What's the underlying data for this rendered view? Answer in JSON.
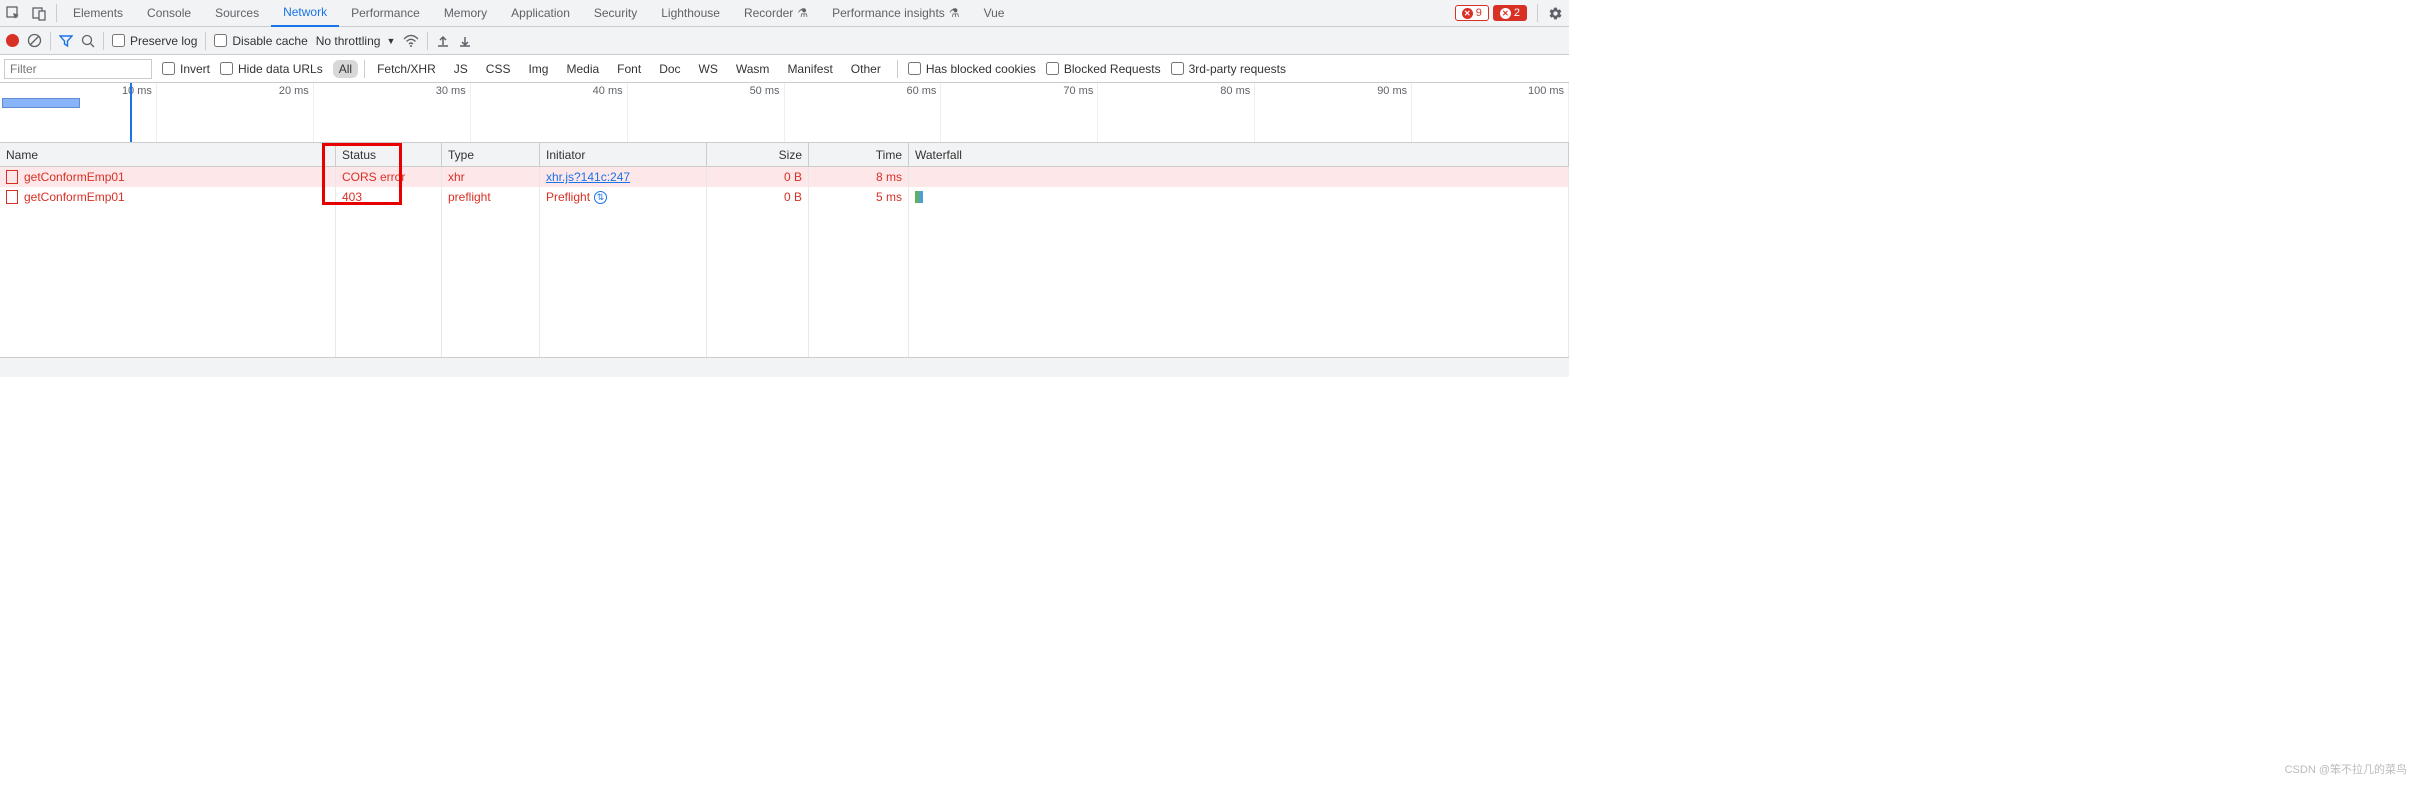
{
  "topbar": {
    "tabs": [
      "Elements",
      "Console",
      "Sources",
      "Network",
      "Performance",
      "Memory",
      "Application",
      "Security",
      "Lighthouse",
      "Recorder",
      "Performance insights",
      "Vue"
    ],
    "active_index": 3,
    "flask_indices": [
      9,
      10
    ],
    "errors_count": "9",
    "errors2_count": "2"
  },
  "toolbar": {
    "preserve_log": "Preserve log",
    "disable_cache": "Disable cache",
    "throttling": "No throttling"
  },
  "filterbar": {
    "filter_placeholder": "Filter",
    "invert": "Invert",
    "hide_data_urls": "Hide data URLs",
    "types": [
      "All",
      "Fetch/XHR",
      "JS",
      "CSS",
      "Img",
      "Media",
      "Font",
      "Doc",
      "WS",
      "Wasm",
      "Manifest",
      "Other"
    ],
    "types_active_index": 0,
    "blocked_cookies": "Has blocked cookies",
    "blocked_requests": "Blocked Requests",
    "third_party": "3rd-party requests"
  },
  "timeline": {
    "labels": [
      "10 ms",
      "20 ms",
      "30 ms",
      "40 ms",
      "50 ms",
      "60 ms",
      "70 ms",
      "80 ms",
      "90 ms",
      "100 ms"
    ]
  },
  "columns": {
    "name": "Name",
    "status": "Status",
    "type": "Type",
    "initiator": "Initiator",
    "size": "Size",
    "time": "Time",
    "waterfall": "Waterfall"
  },
  "rows": [
    {
      "name": "getConformEmp01",
      "status": "CORS error",
      "type": "xhr",
      "initiator": "xhr.js?141c:247",
      "initiator_link": true,
      "size": "0 B",
      "time": "8 ms",
      "pink": true,
      "wf": false
    },
    {
      "name": "getConformEmp01",
      "status": "403",
      "type": "preflight",
      "initiator": "Preflight",
      "initiator_link": false,
      "size": "0 B",
      "time": "5 ms",
      "pink": false,
      "wf": true
    }
  ],
  "watermark": "CSDN @笨不拉几的菜鸟"
}
